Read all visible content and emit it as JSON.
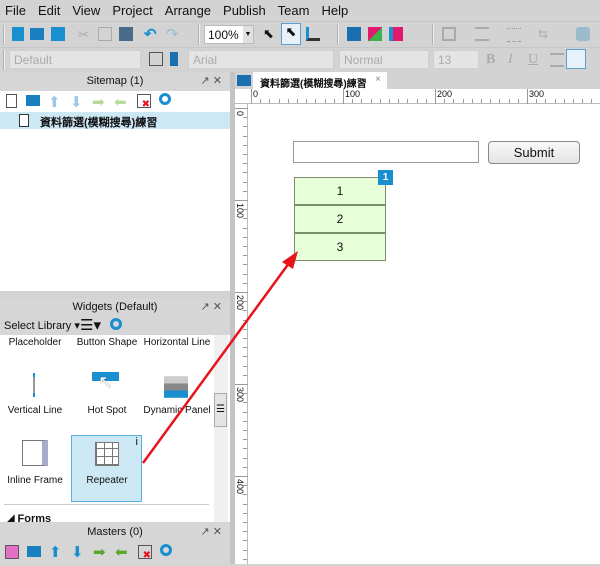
{
  "menu": [
    "File",
    "Edit",
    "View",
    "Project",
    "Arrange",
    "Publish",
    "Team",
    "Help"
  ],
  "toolbar": {
    "zoom": "100%",
    "style": "Default",
    "font": "Arial",
    "weight": "Normal",
    "size": "13",
    "bold": "B",
    "italic": "I",
    "underline": "U"
  },
  "sitemap": {
    "title": "Sitemap (1)",
    "page": "資料篩選(模糊搜尋)練習"
  },
  "widgets": {
    "title": "Widgets (Default)",
    "select_library": "Select Library",
    "items": [
      "Placeholder",
      "Button Shape",
      "Horizontal Line",
      "Vertical Line",
      "Hot Spot",
      "Dynamic Panel",
      "Inline Frame",
      "Repeater"
    ],
    "section": "Forms",
    "info": "i"
  },
  "masters": {
    "title": "Masters (0)"
  },
  "tab": {
    "label": "資料篩選(模糊搜尋)練習",
    "close": "×"
  },
  "ruler": {
    "h": [
      "0",
      "100",
      "200",
      "300"
    ],
    "v": [
      "0",
      "100",
      "200",
      "300",
      "400"
    ]
  },
  "canvas": {
    "input_value": "",
    "submit": "Submit",
    "repeater_rows": [
      "1",
      "2",
      "3"
    ],
    "badge": "1"
  },
  "colors": {
    "accent": "#1a8fd0",
    "selected": "#cde8f5",
    "repeater": "#e6ffd9",
    "arrow": "#e8141b"
  }
}
